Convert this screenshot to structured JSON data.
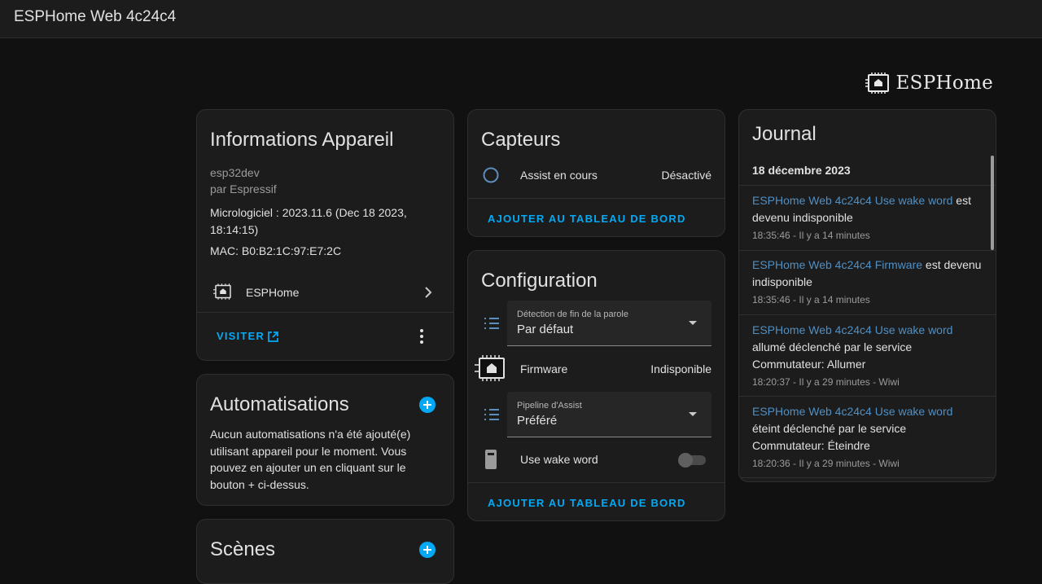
{
  "header": {
    "title": "ESPHome Web 4c24c4"
  },
  "logo": {
    "text": "ESPHome"
  },
  "device_info": {
    "title": "Informations Appareil",
    "model": "esp32dev",
    "manufacturer": "par Espressif",
    "firmware": "Micrologiciel : 2023.11.6 (Dec 18 2023, 18:14:15)",
    "mac": "MAC: B0:B2:1C:97:E7:2C",
    "integration": "ESPHome",
    "visit_label": "VISITER"
  },
  "automations": {
    "title": "Automatisations",
    "text": "Aucun automatisations n'a été ajouté(e) utilisant appareil pour le moment. Vous pouvez en ajouter un en cliquant sur le bouton + ci-dessus."
  },
  "scenes": {
    "title": "Scènes"
  },
  "sensors": {
    "title": "Capteurs",
    "rows": [
      {
        "label": "Assist en cours",
        "value": "Désactivé"
      }
    ],
    "add_label": "AJOUTER AU TABLEAU DE BORD"
  },
  "configuration": {
    "title": "Configuration",
    "selects": [
      {
        "label": "Détection de fin de la parole",
        "value": "Par défaut"
      },
      {
        "label": "Pipeline d'Assist",
        "value": "Préféré"
      }
    ],
    "firmware": {
      "label": "Firmware",
      "value": "Indisponible"
    },
    "wake_word": {
      "label": "Use wake word",
      "on": false
    },
    "add_label": "AJOUTER AU TABLEAU DE BORD"
  },
  "journal": {
    "title": "Journal",
    "date": "18 décembre 2023",
    "entries": [
      {
        "link": "ESPHome Web 4c24c4 Use wake word",
        "text1": " est",
        "text2": "devenu indisponible",
        "text3": "",
        "time": "18:35:46 - Il y a 14 minutes"
      },
      {
        "link": "ESPHome Web 4c24c4 Firmware",
        "text1": " est devenu",
        "text2": "indisponible",
        "text3": "",
        "time": "18:35:46 - Il y a 14 minutes"
      },
      {
        "link": "ESPHome Web 4c24c4 Use wake word",
        "text1": "",
        "text2": "allumé déclenché par le service",
        "text3": "Commutateur: Allumer",
        "time": "18:20:37 - Il y a 29 minutes - Wiwi"
      },
      {
        "link": "ESPHome Web 4c24c4 Use wake word",
        "text1": "",
        "text2": "éteint déclenché par le service",
        "text3": "Commutateur: Éteindre",
        "time": "18:20:36 - Il y a 29 minutes - Wiwi"
      }
    ]
  },
  "colors": {
    "accent": "#03a9f4",
    "link": "#4f8fc4",
    "card": "#1c1c1c",
    "background": "#111111"
  }
}
